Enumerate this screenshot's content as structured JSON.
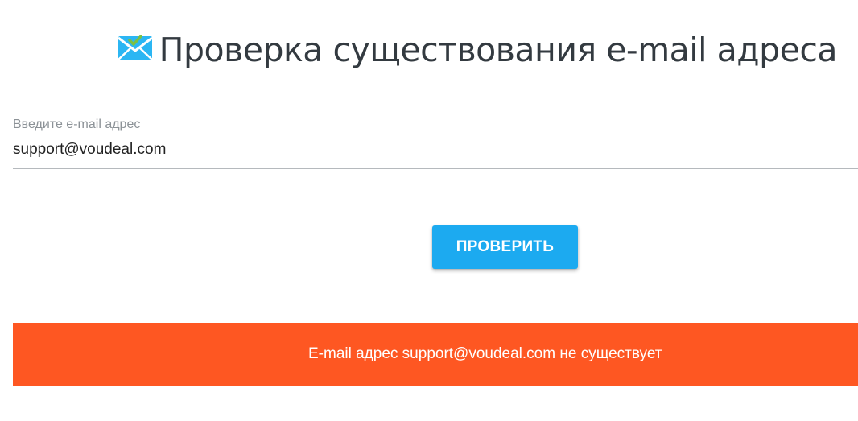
{
  "header": {
    "title": "Проверка существования e-mail адреса",
    "icon": "envelope-check-icon"
  },
  "form": {
    "email_label": "Введите e-mail адрес",
    "email_value": "support@voudeal.com",
    "submit_label": "ПРОВЕРИТЬ"
  },
  "result": {
    "message": "E-mail адрес support@voudeal.com не существует",
    "status": "error"
  },
  "colors": {
    "button_bg": "#1caaf0",
    "error_banner_bg": "#fe5722",
    "icon_blue": "#2bb6f3",
    "icon_check": "#7bc043"
  }
}
